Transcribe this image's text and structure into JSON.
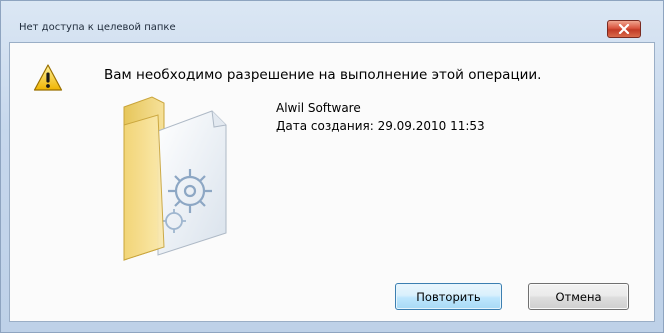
{
  "window": {
    "title": "Нет доступа к целевой папке"
  },
  "dialog": {
    "message": "Вам необходимо разрешение на выполнение этой операции.",
    "item_name": "Alwil Software",
    "item_date": "Дата создания: 29.09.2010 11:53"
  },
  "buttons": {
    "retry_label": "Повторить",
    "cancel_label": "Отмена"
  },
  "icons": {
    "warning": "warning-icon",
    "folder": "folder-icon",
    "close": "close-icon"
  },
  "colors": {
    "close_button": "#c9452e",
    "default_button_border": "#3c7fb1"
  }
}
